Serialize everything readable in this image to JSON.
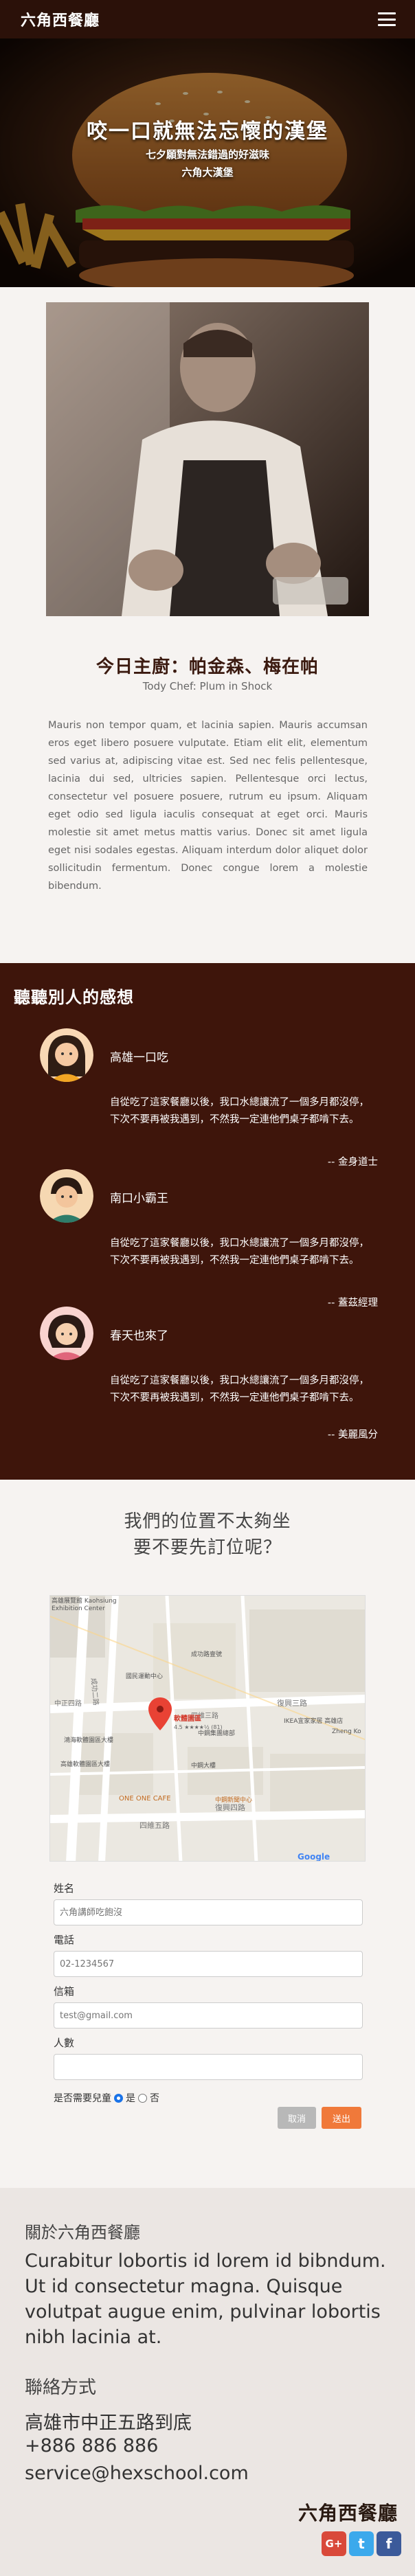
{
  "nav": {
    "brand": "六角西餐廳"
  },
  "hero": {
    "title": "咬一口就無法忘懷的漢堡",
    "subtitle_1": "七夕願對無法錯過的好滋味",
    "subtitle_2": "六角大漢堡"
  },
  "chef": {
    "title": "今日主廚：帕金森、梅在帕",
    "subtitle": "Tody Chef: Plum in Shock",
    "bio": "Mauris non tempor quam, et lacinia sapien. Mauris accumsan eros eget libero posuere vulputate. Etiam elit elit, elementum sed varius at, adipiscing vitae est. Sed nec felis pellentesque, lacinia dui sed, ultricies sapien. Pellentesque orci lectus, consectetur vel posuere posuere, rutrum eu ipsum. Aliquam eget odio sed ligula iaculis consequat at eget orci. Mauris molestie sit amet metus mattis varius. Donec sit amet ligula eget nisi sodales egestas. Aliquam interdum dolor aliquet dolor sollicitudin fermentum. Donec congue lorem a molestie bibendum."
  },
  "testimonials": {
    "heading": "聽聽別人的感想",
    "items": [
      {
        "name": "高雄一口吃",
        "text": "自從吃了這家餐廳以後，我口水總讓流了一個多月都沒停，下次不要再被我遇到，不然我一定連他們桌子都啃下去。",
        "sign": "-- 金身道士"
      },
      {
        "name": "南口小霸王",
        "text": "自從吃了這家餐廳以後，我口水總讓流了一個多月都沒停，下次不要再被我遇到，不然我一定連他們桌子都啃下去。",
        "sign": "-- 蓋茲經理"
      },
      {
        "name": "春天也來了",
        "text": "自從吃了這家餐廳以後，我口水總讓流了一個多月都沒停，下次不要再被我遇到，不然我一定連他們桌子都啃下去。",
        "sign": "-- 美麗風分"
      }
    ]
  },
  "reservation": {
    "title_1": "我們的位置不太夠坐",
    "title_2": "要不要先訂位呢？",
    "map": {
      "poi_top_left_1": "高雄展覽館 Kaohsiung",
      "poi_top_left_2": "Exhibition Center",
      "street_1": "成功二路",
      "street_2": "復興三路",
      "street_3": "復興四路",
      "street_4": "中正四路",
      "street_5": "四維五路",
      "street_6": "四維三路",
      "poi_1": "國民運動中心",
      "poi_2": "成功路壹號",
      "poi_3": "IKEA宜家家居 高雄店",
      "poi_4": "鴻海軟體園區大樓",
      "poi_5": "高雄軟體園區大樓",
      "poi_6": "ONE ONE CAFE",
      "poi_7": "中鋼大樓",
      "poi_8": "中鋼集團總部",
      "poi_9": "中鋼新聞中心",
      "poi_10": "Zheng Ko",
      "marker_label": "軟體園區",
      "marker_sub": "4.5 ★★★★½ (81)",
      "google": "Google"
    },
    "form": {
      "name_label": "姓名",
      "name_placeholder": "六角講師吃飽沒",
      "phone_label": "電話",
      "phone_placeholder": "02-1234567",
      "email_label": "信箱",
      "email_placeholder": "test@gmail.com",
      "people_label": "人數",
      "people_placeholder": "",
      "kids_chair_label": "是否需要兒童",
      "yes_label": "是",
      "no_label": "否",
      "cancel_label": "取消",
      "submit_label": "送出"
    }
  },
  "footer": {
    "about_heading": "關於六角西餐廳",
    "about_text": "Curabitur lobortis id lorem id bibndum. Ut id consectetur magna. Quisque volutpat augue enim, pulvinar lobortis nibh lacinia at.",
    "contact_heading": "聯絡方式",
    "address": "高雄市中正五路到底",
    "phone": "+886 886 886",
    "email": "service@hexschool.com",
    "brand": "六角西餐廳",
    "socials": [
      {
        "name": "google-plus-icon",
        "glyph": "G+",
        "color": "#d9493a"
      },
      {
        "name": "twitter-icon",
        "glyph": "t",
        "color": "#3ba9ec"
      },
      {
        "name": "facebook-icon",
        "glyph": "f",
        "color": "#3b5a9a"
      }
    ]
  }
}
